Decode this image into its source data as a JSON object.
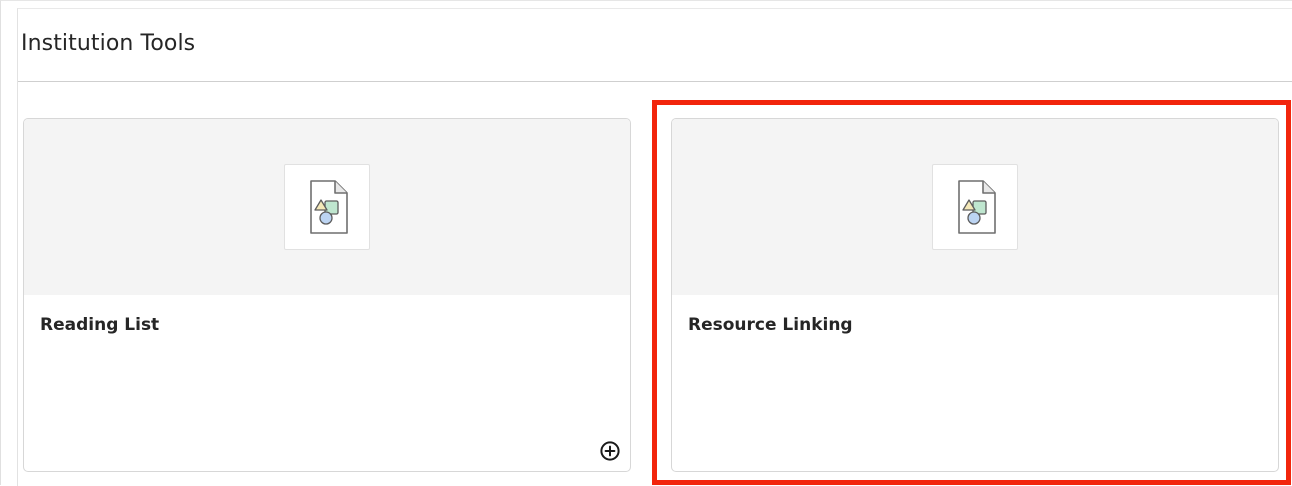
{
  "section": {
    "title": "Institution Tools"
  },
  "cards": [
    {
      "title": "Reading List",
      "icon": "file-shapes-icon",
      "has_add_button": true
    },
    {
      "title": "Resource Linking",
      "icon": "file-shapes-icon",
      "has_add_button": false,
      "highlighted": true
    }
  ],
  "add_button": {
    "icon": "plus-circle-icon"
  },
  "colors": {
    "highlight": "#f2250c",
    "media_background": "#f4f4f4",
    "text": "#262626"
  }
}
